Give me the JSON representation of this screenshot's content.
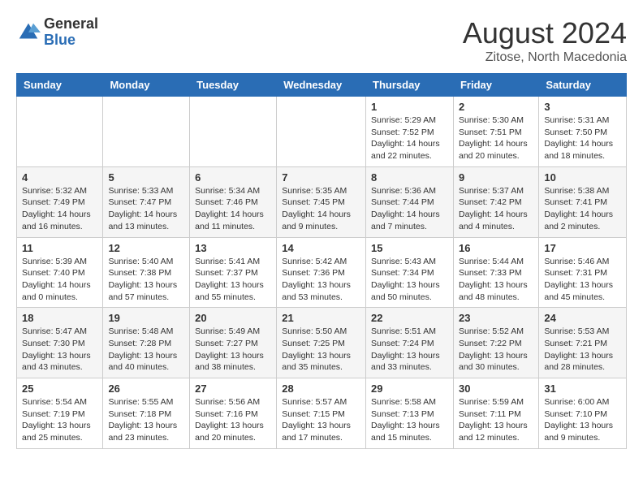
{
  "logo": {
    "general": "General",
    "blue": "Blue"
  },
  "header": {
    "month": "August 2024",
    "location": "Zitose, North Macedonia"
  },
  "weekdays": [
    "Sunday",
    "Monday",
    "Tuesday",
    "Wednesday",
    "Thursday",
    "Friday",
    "Saturday"
  ],
  "weeks": [
    [
      {
        "day": "",
        "info": ""
      },
      {
        "day": "",
        "info": ""
      },
      {
        "day": "",
        "info": ""
      },
      {
        "day": "",
        "info": ""
      },
      {
        "day": "1",
        "info": "Sunrise: 5:29 AM\nSunset: 7:52 PM\nDaylight: 14 hours\nand 22 minutes."
      },
      {
        "day": "2",
        "info": "Sunrise: 5:30 AM\nSunset: 7:51 PM\nDaylight: 14 hours\nand 20 minutes."
      },
      {
        "day": "3",
        "info": "Sunrise: 5:31 AM\nSunset: 7:50 PM\nDaylight: 14 hours\nand 18 minutes."
      }
    ],
    [
      {
        "day": "4",
        "info": "Sunrise: 5:32 AM\nSunset: 7:49 PM\nDaylight: 14 hours\nand 16 minutes."
      },
      {
        "day": "5",
        "info": "Sunrise: 5:33 AM\nSunset: 7:47 PM\nDaylight: 14 hours\nand 13 minutes."
      },
      {
        "day": "6",
        "info": "Sunrise: 5:34 AM\nSunset: 7:46 PM\nDaylight: 14 hours\nand 11 minutes."
      },
      {
        "day": "7",
        "info": "Sunrise: 5:35 AM\nSunset: 7:45 PM\nDaylight: 14 hours\nand 9 minutes."
      },
      {
        "day": "8",
        "info": "Sunrise: 5:36 AM\nSunset: 7:44 PM\nDaylight: 14 hours\nand 7 minutes."
      },
      {
        "day": "9",
        "info": "Sunrise: 5:37 AM\nSunset: 7:42 PM\nDaylight: 14 hours\nand 4 minutes."
      },
      {
        "day": "10",
        "info": "Sunrise: 5:38 AM\nSunset: 7:41 PM\nDaylight: 14 hours\nand 2 minutes."
      }
    ],
    [
      {
        "day": "11",
        "info": "Sunrise: 5:39 AM\nSunset: 7:40 PM\nDaylight: 14 hours\nand 0 minutes."
      },
      {
        "day": "12",
        "info": "Sunrise: 5:40 AM\nSunset: 7:38 PM\nDaylight: 13 hours\nand 57 minutes."
      },
      {
        "day": "13",
        "info": "Sunrise: 5:41 AM\nSunset: 7:37 PM\nDaylight: 13 hours\nand 55 minutes."
      },
      {
        "day": "14",
        "info": "Sunrise: 5:42 AM\nSunset: 7:36 PM\nDaylight: 13 hours\nand 53 minutes."
      },
      {
        "day": "15",
        "info": "Sunrise: 5:43 AM\nSunset: 7:34 PM\nDaylight: 13 hours\nand 50 minutes."
      },
      {
        "day": "16",
        "info": "Sunrise: 5:44 AM\nSunset: 7:33 PM\nDaylight: 13 hours\nand 48 minutes."
      },
      {
        "day": "17",
        "info": "Sunrise: 5:46 AM\nSunset: 7:31 PM\nDaylight: 13 hours\nand 45 minutes."
      }
    ],
    [
      {
        "day": "18",
        "info": "Sunrise: 5:47 AM\nSunset: 7:30 PM\nDaylight: 13 hours\nand 43 minutes."
      },
      {
        "day": "19",
        "info": "Sunrise: 5:48 AM\nSunset: 7:28 PM\nDaylight: 13 hours\nand 40 minutes."
      },
      {
        "day": "20",
        "info": "Sunrise: 5:49 AM\nSunset: 7:27 PM\nDaylight: 13 hours\nand 38 minutes."
      },
      {
        "day": "21",
        "info": "Sunrise: 5:50 AM\nSunset: 7:25 PM\nDaylight: 13 hours\nand 35 minutes."
      },
      {
        "day": "22",
        "info": "Sunrise: 5:51 AM\nSunset: 7:24 PM\nDaylight: 13 hours\nand 33 minutes."
      },
      {
        "day": "23",
        "info": "Sunrise: 5:52 AM\nSunset: 7:22 PM\nDaylight: 13 hours\nand 30 minutes."
      },
      {
        "day": "24",
        "info": "Sunrise: 5:53 AM\nSunset: 7:21 PM\nDaylight: 13 hours\nand 28 minutes."
      }
    ],
    [
      {
        "day": "25",
        "info": "Sunrise: 5:54 AM\nSunset: 7:19 PM\nDaylight: 13 hours\nand 25 minutes."
      },
      {
        "day": "26",
        "info": "Sunrise: 5:55 AM\nSunset: 7:18 PM\nDaylight: 13 hours\nand 23 minutes."
      },
      {
        "day": "27",
        "info": "Sunrise: 5:56 AM\nSunset: 7:16 PM\nDaylight: 13 hours\nand 20 minutes."
      },
      {
        "day": "28",
        "info": "Sunrise: 5:57 AM\nSunset: 7:15 PM\nDaylight: 13 hours\nand 17 minutes."
      },
      {
        "day": "29",
        "info": "Sunrise: 5:58 AM\nSunset: 7:13 PM\nDaylight: 13 hours\nand 15 minutes."
      },
      {
        "day": "30",
        "info": "Sunrise: 5:59 AM\nSunset: 7:11 PM\nDaylight: 13 hours\nand 12 minutes."
      },
      {
        "day": "31",
        "info": "Sunrise: 6:00 AM\nSunset: 7:10 PM\nDaylight: 13 hours\nand 9 minutes."
      }
    ]
  ]
}
